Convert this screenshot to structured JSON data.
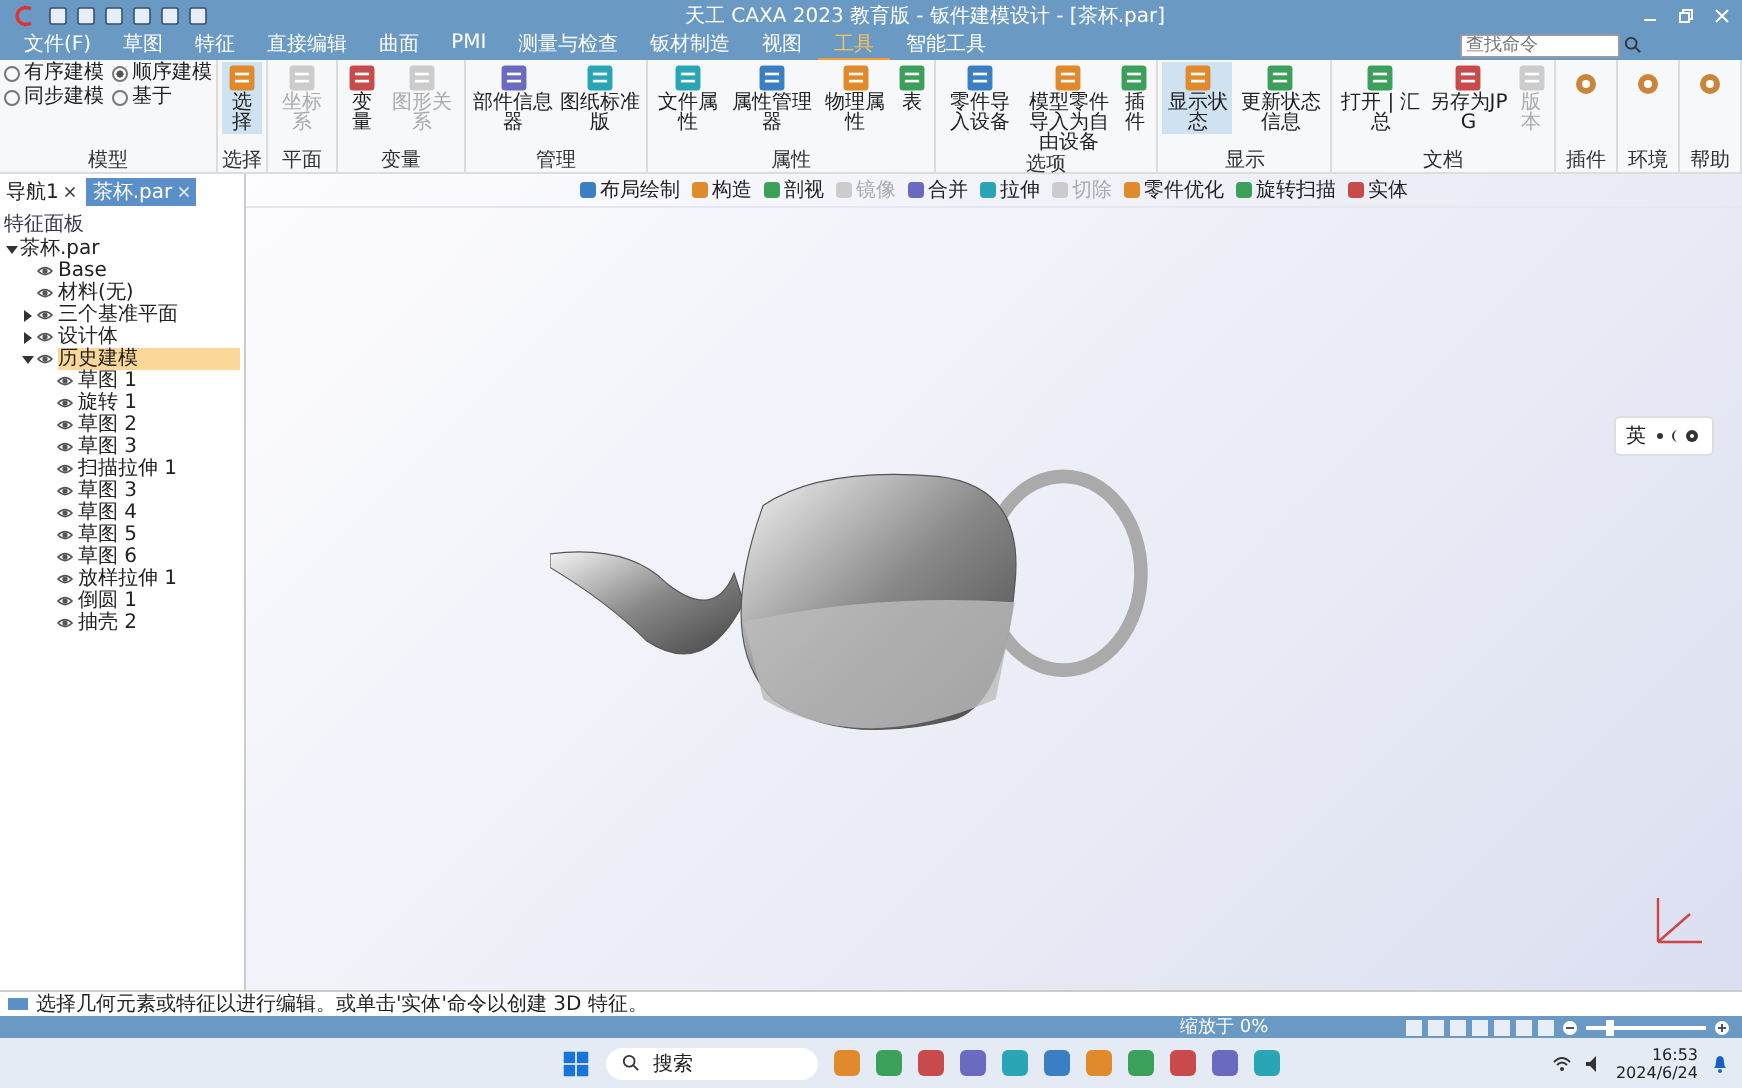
{
  "window": {
    "title": "天工 CAXA 2023 教育版 - 钣件建模设计 - [茶杯.par]"
  },
  "search": {
    "placeholder": "查找命令"
  },
  "menu_tabs": [
    {
      "label": "文件(F)",
      "selected": false
    },
    {
      "label": "草图",
      "selected": false
    },
    {
      "label": "特征",
      "selected": false
    },
    {
      "label": "直接编辑",
      "selected": false
    },
    {
      "label": "曲面",
      "selected": false
    },
    {
      "label": "PMI",
      "selected": false
    },
    {
      "label": "测量与检查",
      "selected": false
    },
    {
      "label": "钣材制造",
      "selected": false
    },
    {
      "label": "视图",
      "selected": false
    },
    {
      "label": "工具",
      "selected": true
    },
    {
      "label": "智能工具",
      "selected": false
    }
  ],
  "modeling_modes": [
    {
      "label": "有序建模",
      "selected": false
    },
    {
      "label": "顺序建模",
      "selected": true
    },
    {
      "label": "同步建模",
      "selected": false
    },
    {
      "label": "基于",
      "selected": false
    }
  ],
  "ribbon_groups": [
    {
      "label": "模型"
    },
    {
      "label": "选择",
      "buttons": [
        {
          "label": "选择",
          "selected": true,
          "disabled": false
        }
      ]
    },
    {
      "label": "平面",
      "buttons": [
        {
          "label": "坐标系",
          "selected": false,
          "disabled": true
        }
      ]
    },
    {
      "label": "变量",
      "buttons": [
        {
          "label": "变量",
          "selected": false,
          "disabled": false
        },
        {
          "label": "图形关系",
          "selected": false,
          "disabled": true
        }
      ]
    },
    {
      "label": "管理",
      "buttons": [
        {
          "label": "部件信息器",
          "selected": false,
          "disabled": false
        },
        {
          "label": "图纸标准版",
          "selected": false,
          "disabled": false
        }
      ]
    },
    {
      "label": "属性",
      "buttons": [
        {
          "label": "文件属性",
          "selected": false,
          "disabled": false
        },
        {
          "label": "属性管理器",
          "selected": false,
          "disabled": false
        },
        {
          "label": "物理属性",
          "selected": false,
          "disabled": false
        },
        {
          "label": "表",
          "selected": false,
          "disabled": false
        }
      ]
    },
    {
      "label": "选项",
      "buttons": [
        {
          "label": "零件导入设备",
          "selected": false,
          "disabled": false
        },
        {
          "label": "模型零件导入为自由设备",
          "selected": false,
          "disabled": false
        },
        {
          "label": "插件",
          "selected": false,
          "disabled": false
        }
      ]
    },
    {
      "label": "显示",
      "buttons": [
        {
          "label": "显示状态",
          "selected": true,
          "disabled": false
        },
        {
          "label": "更新状态信息",
          "selected": false,
          "disabled": false
        }
      ]
    },
    {
      "label": "文档",
      "buttons": [
        {
          "label": "打开 | 汇总",
          "selected": false,
          "disabled": false
        },
        {
          "label": "另存为JPG",
          "selected": false,
          "disabled": false
        },
        {
          "label": "版本",
          "selected": false,
          "disabled": true
        }
      ]
    },
    {
      "label": "插件"
    },
    {
      "label": "环境"
    },
    {
      "label": "帮助"
    }
  ],
  "view_toolbar": [
    {
      "label": "布局绘制",
      "disabled": false
    },
    {
      "label": "构造",
      "disabled": false
    },
    {
      "label": "剖视",
      "disabled": false
    },
    {
      "label": "镜像",
      "disabled": true
    },
    {
      "label": "合并",
      "disabled": false
    },
    {
      "label": "拉伸",
      "disabled": false
    },
    {
      "label": "切除",
      "disabled": true
    },
    {
      "label": "零件优化",
      "disabled": false
    },
    {
      "label": "旋转扫描",
      "disabled": false
    },
    {
      "label": "实体",
      "disabled": false
    }
  ],
  "doc_tabs": [
    {
      "label": "导航1",
      "selected": false
    },
    {
      "label": "茶杯.par",
      "selected": true
    }
  ],
  "tree": {
    "title": "特征面板",
    "items": [
      {
        "label": "茶杯.par",
        "selected": false,
        "expanded": true,
        "children": [
          {
            "label": "Base",
            "selected": false
          },
          {
            "label": "材料(无)",
            "selected": false
          },
          {
            "label": "三个基准平面",
            "selected": false,
            "expanded": false
          },
          {
            "label": "设计体",
            "selected": false,
            "expanded": false
          },
          {
            "label": "历史建模",
            "selected": true,
            "expanded": true,
            "children": [
              {
                "label": "草图 1",
                "selected": false
              },
              {
                "label": "旋转 1",
                "selected": false
              },
              {
                "label": "草图 2",
                "selected": false
              },
              {
                "label": "草图 3",
                "selected": false
              },
              {
                "label": "扫描拉伸 1",
                "selected": false
              },
              {
                "label": "草图 3",
                "selected": false
              },
              {
                "label": "草图 4",
                "selected": false
              },
              {
                "label": "草图 5",
                "selected": false
              },
              {
                "label": "草图 6",
                "selected": false
              },
              {
                "label": "放样拉伸 1",
                "selected": false
              },
              {
                "label": "倒圆 1",
                "selected": false
              },
              {
                "label": "抽壳 2",
                "selected": false
              }
            ]
          }
        ]
      }
    ]
  },
  "ime": {
    "label": "英"
  },
  "prompt": "选择几何元素或特征以进行编辑。或单击'实体'命令以创建 3D 特征。",
  "status_bar": {
    "text": "缩放于 0%",
    "zoom": {
      "level": 0.2
    }
  },
  "taskbar": {
    "search": "搜索",
    "time": "16:53",
    "date": "2024/6/24"
  }
}
